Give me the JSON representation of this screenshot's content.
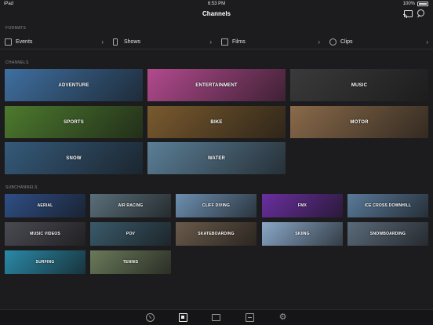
{
  "status": {
    "device": "iPad",
    "time": "6:53 PM",
    "battery": "100%"
  },
  "nav": {
    "title": "Channels"
  },
  "formats": {
    "label": "FORMATS",
    "items": [
      {
        "label": "Events",
        "icon": "ticket-icon"
      },
      {
        "label": "Shows",
        "icon": "phone-icon"
      },
      {
        "label": "Films",
        "icon": "film-icon"
      },
      {
        "label": "Clips",
        "icon": "play-circle-icon"
      }
    ]
  },
  "channels": {
    "label": "CHANNELS",
    "items": [
      {
        "label": "ADVENTURE",
        "color": "#3f6fa0"
      },
      {
        "label": "ENTERTAINMENT",
        "color": "#b24a8e"
      },
      {
        "label": "MUSIC",
        "color": "#3a3a3a"
      },
      {
        "label": "SPORTS",
        "color": "#4d7a2e"
      },
      {
        "label": "BIKE",
        "color": "#7a5a2e"
      },
      {
        "label": "MOTOR",
        "color": "#8a6a4a"
      },
      {
        "label": "SNOW",
        "color": "#355a7a"
      },
      {
        "label": "WATER",
        "color": "#5b7f97"
      }
    ]
  },
  "subchannels": {
    "label": "SUBCHANNELS",
    "items": [
      {
        "label": "AERIAL",
        "color": "#2f4f86"
      },
      {
        "label": "AIR RACING",
        "color": "#5a6f7a"
      },
      {
        "label": "CLIFF DIVING",
        "color": "#6d8fb0"
      },
      {
        "label": "FMX",
        "color": "#6a2fa0"
      },
      {
        "label": "ICE CROSS DOWNHILL",
        "color": "#5a7a9a"
      },
      {
        "label": "MUSIC VIDEOS",
        "color": "#4a4a52"
      },
      {
        "label": "POV",
        "color": "#3a5a6a"
      },
      {
        "label": "SKATEBOARDING",
        "color": "#6a5a4a"
      },
      {
        "label": "SKIING",
        "color": "#8aa8c8"
      },
      {
        "label": "SNOWBOARDING",
        "color": "#5a6a7a"
      },
      {
        "label": "SURFING",
        "color": "#2a8aa8"
      },
      {
        "label": "TENNIS",
        "color": "#6a7a5a"
      }
    ]
  },
  "tabbar": [
    {
      "name": "tab-recent",
      "icon": "clock-icon"
    },
    {
      "name": "tab-channels",
      "icon": "channels-icon"
    },
    {
      "name": "tab-tv",
      "icon": "tv-icon"
    },
    {
      "name": "tab-calendar",
      "icon": "calendar-icon"
    },
    {
      "name": "tab-settings",
      "icon": "gear-icon"
    }
  ]
}
